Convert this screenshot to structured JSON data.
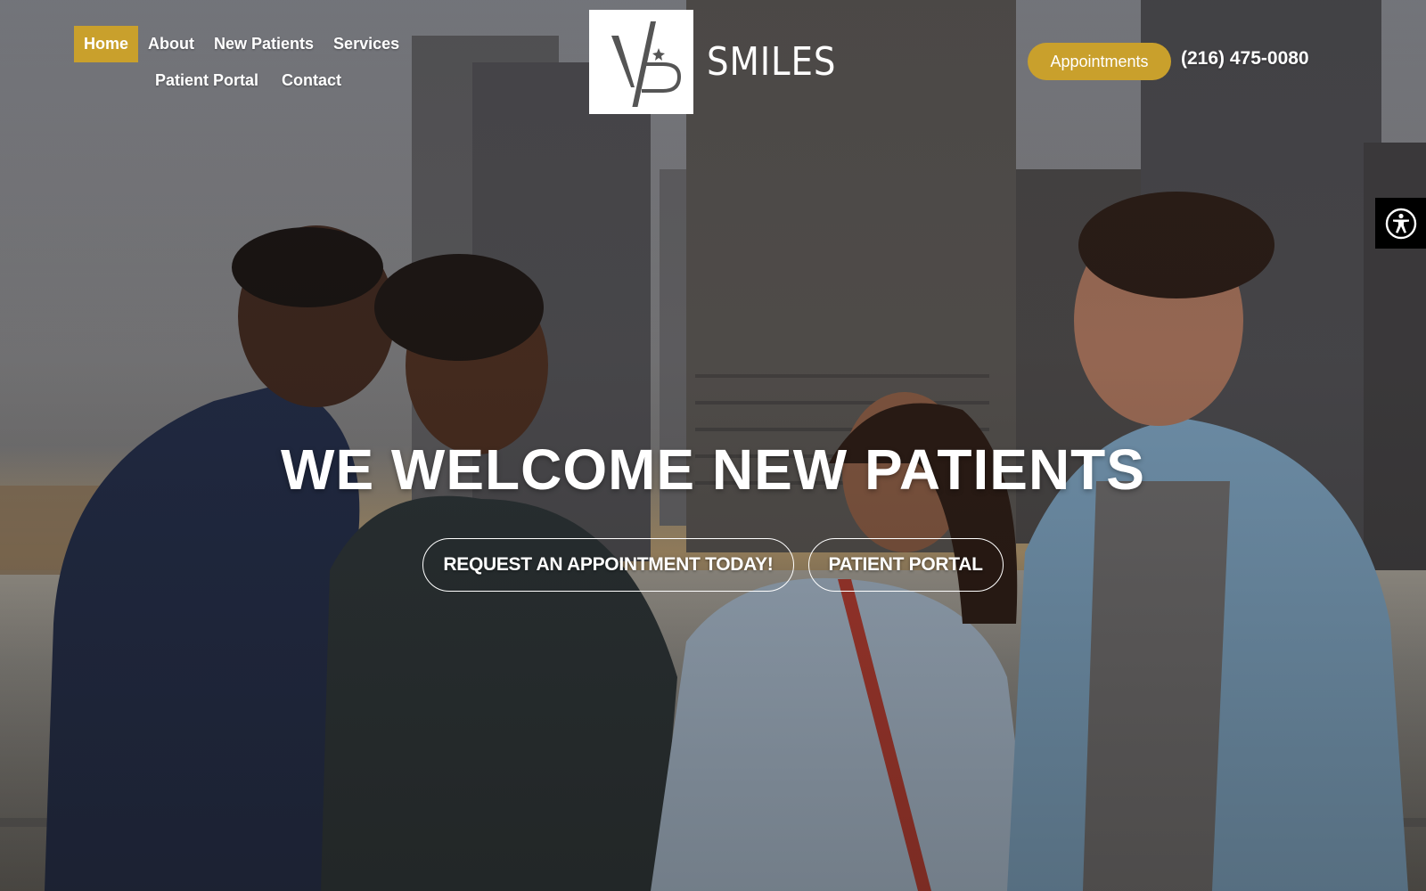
{
  "nav": {
    "items": [
      {
        "label": "Home",
        "active": true
      },
      {
        "label": "About",
        "active": false
      },
      {
        "label": "New Patients",
        "active": false
      },
      {
        "label": "Services",
        "active": false
      },
      {
        "label": "Patient Portal",
        "active": false
      },
      {
        "label": "Contact",
        "active": false
      }
    ]
  },
  "logo": {
    "wordmark": "SMILES",
    "monogram_icon": "vp-monogram-icon"
  },
  "header": {
    "appointments_label": "Appointments",
    "phone": "(216) 475-0080"
  },
  "accessibility": {
    "icon": "accessibility-icon"
  },
  "hero": {
    "headline": "WE WELCOME NEW PATIENTS",
    "cta_primary": "REQUEST AN APPOINTMENT TODAY!",
    "cta_secondary": "PATIENT PORTAL"
  },
  "colors": {
    "accent": "#c9a02c",
    "text": "#ffffff"
  }
}
